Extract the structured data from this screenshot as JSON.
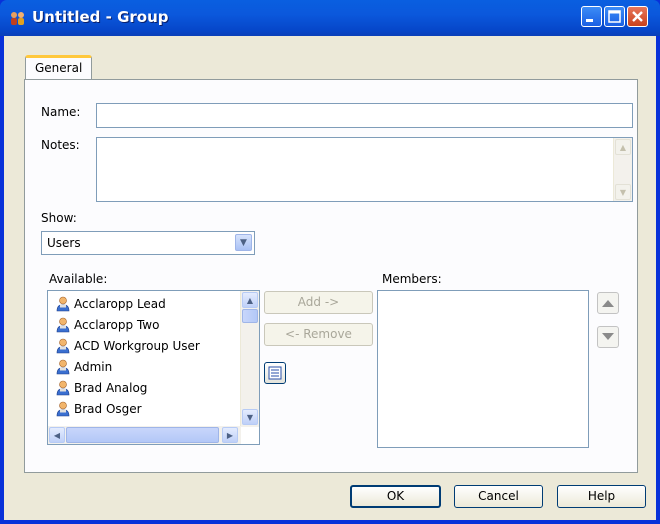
{
  "window": {
    "title": "Untitled - Group"
  },
  "tabs": [
    {
      "label": "General"
    }
  ],
  "form": {
    "name_label": "Name:",
    "name_value": "",
    "notes_label": "Notes:",
    "notes_value": "",
    "show_label": "Show:",
    "show_value": "Users"
  },
  "available": {
    "label": "Available:",
    "items": [
      "Acclaropp Lead",
      "Acclaropp Two",
      "ACD Workgroup User",
      "Admin",
      "Brad Analog",
      "Brad Osger"
    ]
  },
  "members": {
    "label": "Members:",
    "items": []
  },
  "buttons": {
    "add": "Add ->",
    "remove": "<- Remove",
    "ok": "OK",
    "cancel": "Cancel",
    "help": "Help"
  },
  "colors": {
    "title_bar": "#0a5fe0",
    "tab_accent": "#ffc83c",
    "dialog_bg": "#ece9d8"
  }
}
